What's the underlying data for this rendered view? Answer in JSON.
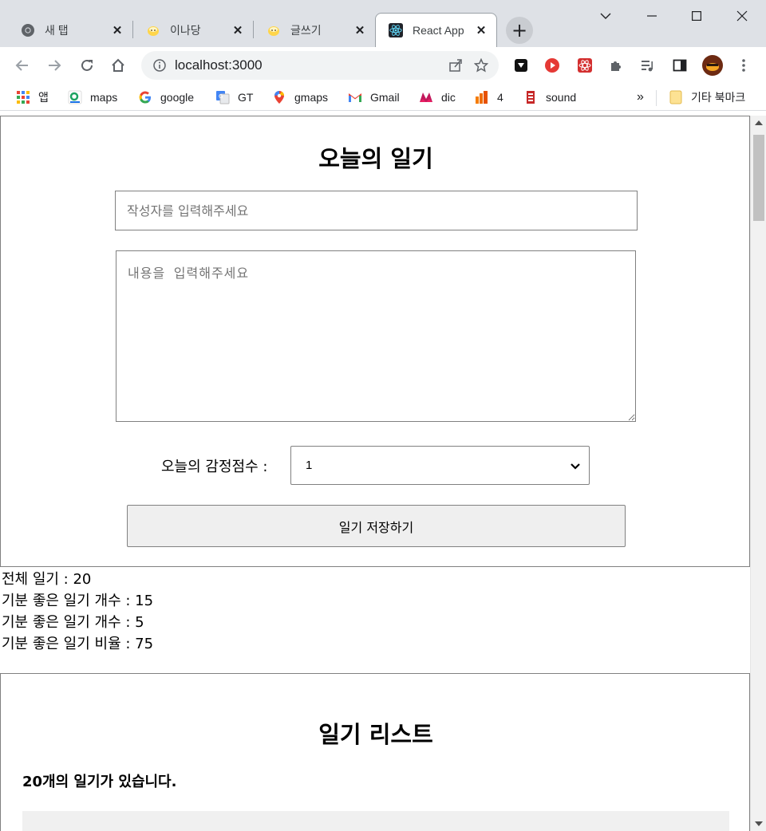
{
  "browser": {
    "tabs": [
      {
        "title": "새 탭",
        "icon": "chrome-icon"
      },
      {
        "title": "이나당",
        "icon": "chick-icon"
      },
      {
        "title": "글쓰기",
        "icon": "chick-icon"
      },
      {
        "title": "React App",
        "icon": "react-icon",
        "active": true
      }
    ],
    "url": "localhost:3000",
    "bookmarks": [
      {
        "label": "앱",
        "icon": "apps-grid-icon"
      },
      {
        "label": "maps",
        "icon": "maps-icon"
      },
      {
        "label": "google",
        "icon": "google-icon"
      },
      {
        "label": "GT",
        "icon": "translate-icon"
      },
      {
        "label": "gmaps",
        "icon": "map-pin-icon"
      },
      {
        "label": "Gmail",
        "icon": "gmail-icon"
      },
      {
        "label": "dic",
        "icon": "dictionary-icon"
      },
      {
        "label": "4",
        "icon": "office-icon"
      },
      {
        "label": "sound",
        "icon": "sound-icon"
      }
    ],
    "overflow": "»",
    "other_bookmarks": "기타 북마크"
  },
  "editor": {
    "title": "오늘의 일기",
    "author_placeholder": "작성자를 입력해주세요",
    "content_placeholder": "내용을 입력해주세요",
    "emotion_label": "오늘의 감정점수 :",
    "emotion_value": "1",
    "save_label": "일기 저장하기"
  },
  "stats": {
    "total": "전체 일기 : 20",
    "good": "기분 좋은 일기 개수 : 15",
    "bad": "기분 좋은 일기 개수 : 5",
    "ratio": "기분 좋은 일기 비율 : 75"
  },
  "list": {
    "title": "일기 리스트",
    "count": "20개의 일기가 있습니다."
  }
}
